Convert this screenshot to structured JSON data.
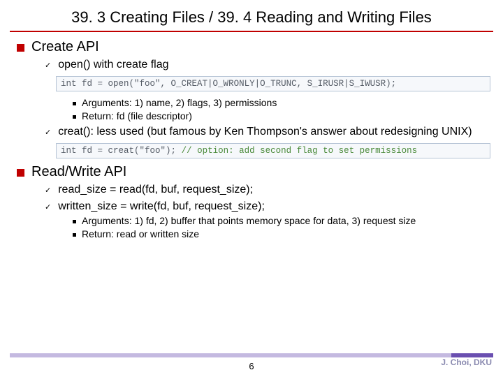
{
  "title": "39. 3 Creating Files / 39. 4 Reading and Writing Files",
  "section1": {
    "heading": "Create API",
    "item1": "open() with create flag",
    "code1_a": "int fd = open(",
    "code1_b": "\"foo\"",
    "code1_c": ", O_CREAT|O_WRONLY|O_TRUNC, S_IRUSR|S_IWUSR);",
    "sub1": "Arguments: 1) name, 2) flags, 3) permissions",
    "sub2": "Return: fd (file descriptor)",
    "item2": "creat(): less used (but famous by Ken Thompson's answer about redesigning UNIX)",
    "code2_a": "int fd = creat(",
    "code2_b": "\"foo\"",
    "code2_c": "); ",
    "code2_comment": "// option: add second flag to set permissions"
  },
  "section2": {
    "heading": "Read/Write API",
    "item1": "read_size = read(fd, buf, request_size);",
    "item2": "written_size = write(fd, buf, request_size);",
    "sub1": "Arguments: 1) fd, 2) buffer that points memory space for data, 3) request size",
    "sub2": "Return: read or written size"
  },
  "page": "6",
  "author": "J. Choi, DKU"
}
